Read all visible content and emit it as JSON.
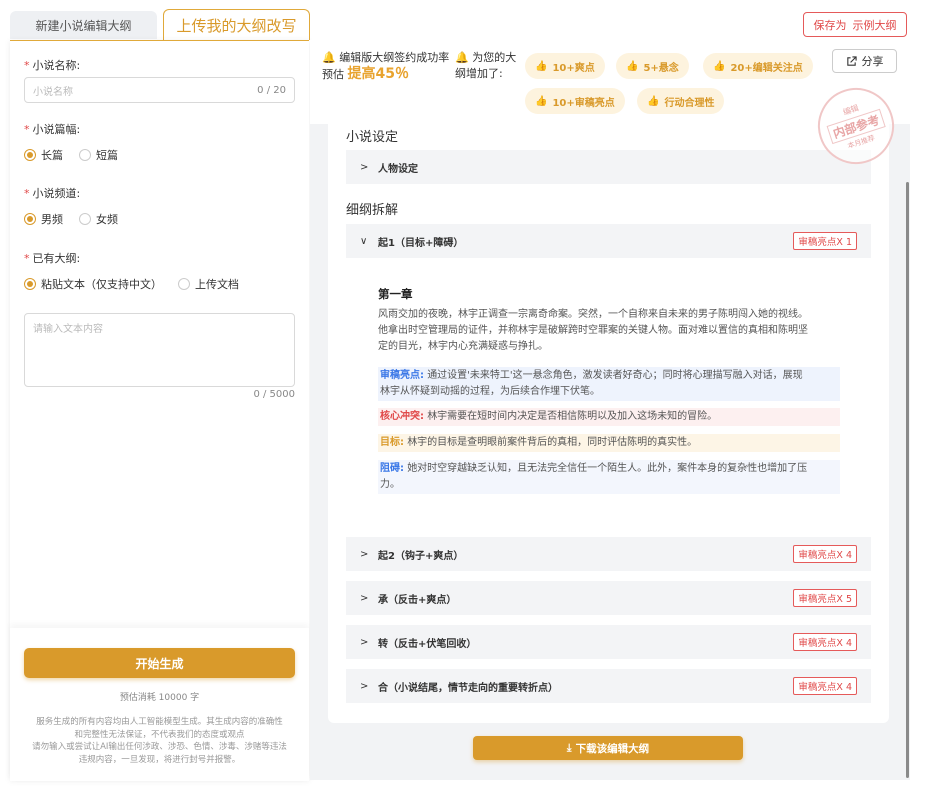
{
  "tabs": [
    {
      "label": "新建小说编辑大纲"
    },
    {
      "label": "上传我的大纲改写"
    }
  ],
  "header": {
    "save_prefix": "保存为",
    "save_label": "示例大纲"
  },
  "form": {
    "name_label": "小说名称:",
    "name_placeholder": "小说名称",
    "name_count": "0 / 20",
    "length_label": "小说篇幅:",
    "length_options": [
      "长篇",
      "短篇"
    ],
    "length_selected": "长篇",
    "channel_label": "小说频道:",
    "channel_options": [
      "男频",
      "女频"
    ],
    "channel_selected": "男频",
    "outline_label": "已有大纲:",
    "outline_options": [
      "粘贴文本（仅支持中文）",
      "上传文档"
    ],
    "outline_selected": "粘贴文本（仅支持中文）",
    "textarea_placeholder": "请输入文本内容",
    "textarea_count": "0 / 5000",
    "generate_label": "开始生成",
    "cost_text": "预估消耗 10000 字",
    "disclaimer_lines": [
      "服务生成的所有内容均由人工智能模型生成。其生成内容的准确性",
      "和完整性无法保证，不代表我们的态度或观点",
      "请勿输入或尝试让AI输出任何涉政、涉恐、色情、涉毒、涉赌等违法",
      "违规内容，一旦发现，将进行封号并报警。"
    ]
  },
  "stats": {
    "rate_line1": "编辑版大纲签约成功率",
    "rate_prefix": "预估",
    "rate_value": "提高45％",
    "added_line1": "为您的大",
    "added_line2": "纲增加了:",
    "pills": [
      "10+爽点",
      "5+悬念",
      "20+编辑关注点",
      "10+审稿亮点",
      "行动合理性"
    ],
    "share_label": "分享"
  },
  "stamp": {
    "top": "编辑",
    "middle": "内部参考",
    "bottom": "本月推荐"
  },
  "content": {
    "settings_title": "小说设定",
    "character_row": "人物设定",
    "breakdown_title": "细纲拆解",
    "sections": [
      {
        "label": "起1（目标+障碍）",
        "tag": "审稿亮点X 1",
        "expanded": true
      },
      {
        "label": "起2（钩子+爽点）",
        "tag": "审稿亮点X 4",
        "expanded": false
      },
      {
        "label": "承（反击+爽点）",
        "tag": "审稿亮点X 5",
        "expanded": false
      },
      {
        "label": "转（反击+伏笔回收）",
        "tag": "审稿亮点X 4",
        "expanded": false
      },
      {
        "label": "合（小说结尾，情节走向的重要转折点）",
        "tag": "审稿亮点X 4",
        "expanded": false
      }
    ],
    "chapter_title": "第一章",
    "chapter_lines": [
      "风雨交加的夜晚，林宇正调查一宗离奇命案。突然，一个自称来自未来的男子陈明闯入她的视线。",
      "他拿出时空管理局的证件，并称林宇是破解跨时空罪案的关键人物。面对难以置信的真相和陈明坚",
      "定的目光，林宇内心充满疑惑与挣扎。"
    ],
    "notes": {
      "highlight_key": "审稿亮点:",
      "highlight_lines": [
        "通过设置'未来特工'这一悬念角色，激发读者好奇心；同时将心理描写融入对话，展现",
        "林宇从怀疑到动摇的过程，为后续合作埋下伏笔。"
      ],
      "conflict_key": "核心冲突:",
      "conflict_text": "林宇需要在短时间内决定是否相信陈明以及加入这场未知的冒险。",
      "goal_key": "目标:",
      "goal_text": "林宇的目标是查明眼前案件背后的真相，同时评估陈明的真实性。",
      "obstacle_key": "阻碍:",
      "obstacle_lines": [
        "她对时空穿越缺乏认知，且无法完全信任一个陌生人。此外，案件本身的复杂性也增加了压",
        "力。"
      ]
    },
    "download_label": "下载该编辑大纲"
  },
  "colors": {
    "accent": "#d99a2b",
    "danger": "#e04848",
    "highlight_blue": "#3b78e7"
  },
  "icons": [
    "bell-icon",
    "thumb-up-icon",
    "share-icon",
    "chevron-right-icon",
    "chevron-down-icon",
    "download-icon"
  ]
}
